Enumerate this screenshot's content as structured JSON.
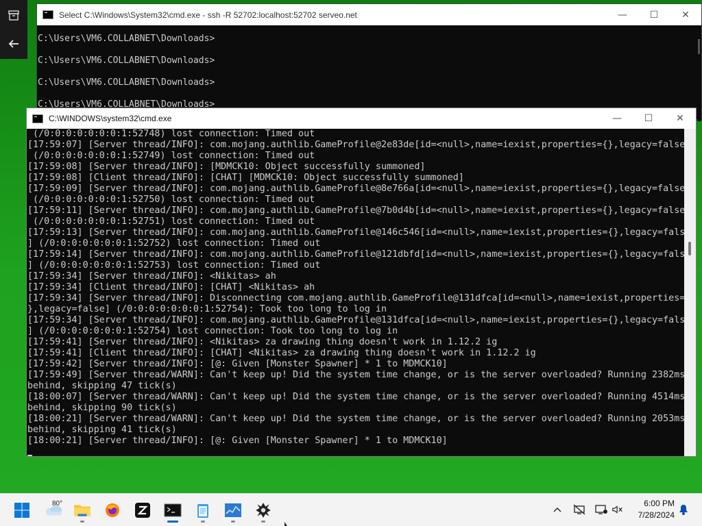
{
  "window_back": {
    "title": "Select C:\\Windows\\System32\\cmd.exe - ssh  -R 52702:localhost:52702 serveo.net",
    "lines": [
      "C:\\Users\\VM6.COLLABNET\\Downloads>",
      "C:\\Users\\VM6.COLLABNET\\Downloads>",
      "C:\\Users\\VM6.COLLABNET\\Downloads>",
      "C:\\Users\\VM6.COLLABNET\\Downloads>"
    ]
  },
  "window_front": {
    "title": "C:\\WINDOWS\\system32\\cmd.exe",
    "lines": [
      " (/0:0:0:0:0:0:0:1:52748) lost connection: Timed out",
      "[17:59:07] [Server thread/INFO]: com.mojang.authlib.GameProfile@2e83de[id=<null>,name=iexist,properties={},legacy=false]",
      " (/0:0:0:0:0:0:0:1:52749) lost connection: Timed out",
      "[17:59:08] [Server thread/INFO]: [MDMCK10: Object successfully summoned]",
      "[17:59:08] [Client thread/INFO]: [CHAT] [MDMCK10: Object successfully summoned]",
      "[17:59:09] [Server thread/INFO]: com.mojang.authlib.GameProfile@8e766a[id=<null>,name=iexist,properties={},legacy=false]",
      " (/0:0:0:0:0:0:0:1:52750) lost connection: Timed out",
      "[17:59:11] [Server thread/INFO]: com.mojang.authlib.GameProfile@7b0d4b[id=<null>,name=iexist,properties={},legacy=false]",
      " (/0:0:0:0:0:0:0:1:52751) lost connection: Timed out",
      "[17:59:13] [Server thread/INFO]: com.mojang.authlib.GameProfile@146c546[id=<null>,name=iexist,properties={},legacy=false",
      "] (/0:0:0:0:0:0:0:1:52752) lost connection: Timed out",
      "[17:59:14] [Server thread/INFO]: com.mojang.authlib.GameProfile@121dbfd[id=<null>,name=iexist,properties={},legacy=false",
      "] (/0:0:0:0:0:0:0:1:52753) lost connection: Timed out",
      "[17:59:34] [Server thread/INFO]: <Nikitas> ah",
      "[17:59:34] [Client thread/INFO]: [CHAT] <Nikitas> ah",
      "[17:59:34] [Server thread/INFO]: Disconnecting com.mojang.authlib.GameProfile@131dfca[id=<null>,name=iexist,properties={",
      "},legacy=false] (/0:0:0:0:0:0:0:1:52754): Took too long to log in",
      "[17:59:34] [Server thread/INFO]: com.mojang.authlib.GameProfile@131dfca[id=<null>,name=iexist,properties={},legacy=false",
      "] (/0:0:0:0:0:0:0:1:52754) lost connection: Took too long to log in",
      "[17:59:41] [Server thread/INFO]: <Nikitas> za drawing thing doesn't work in 1.12.2 ig",
      "[17:59:41] [Client thread/INFO]: [CHAT] <Nikitas> za drawing thing doesn't work in 1.12.2 ig",
      "[17:59:42] [Server thread/INFO]: [@: Given [Monster Spawner] * 1 to MDMCK10]",
      "[17:59:49] [Server thread/WARN]: Can't keep up! Did the system time change, or is the server overloaded? Running 2382ms",
      "behind, skipping 47 tick(s)",
      "[18:00:07] [Server thread/WARN]: Can't keep up! Did the system time change, or is the server overloaded? Running 4514ms",
      "behind, skipping 90 tick(s)",
      "[18:00:21] [Server thread/WARN]: Can't keep up! Did the system time change, or is the server overloaded? Running 2053ms",
      "behind, skipping 41 tick(s)",
      "[18:00:21] [Server thread/INFO]: [@: Given [Monster Spawner] * 1 to MDMCK10]",
      ""
    ]
  },
  "window_controls": {
    "minimize": "—",
    "maximize": "☐",
    "close": "✕"
  },
  "taskbar": {
    "weather_temp": "80°",
    "items": [
      "start-icon",
      "weather-icon",
      "file-explorer-icon",
      "firefox-icon",
      "zed-icon",
      "terminal-icon",
      "notepad-icon",
      "task-manager-icon",
      "minecraft-icon"
    ],
    "time": "6:00 PM",
    "date": "7/28/2024"
  },
  "colors": {
    "terminal_bg": "#0c0c0c",
    "terminal_fg": "#cccccc",
    "desktop_green": "#1fa21f",
    "accent": "#0067c0"
  }
}
